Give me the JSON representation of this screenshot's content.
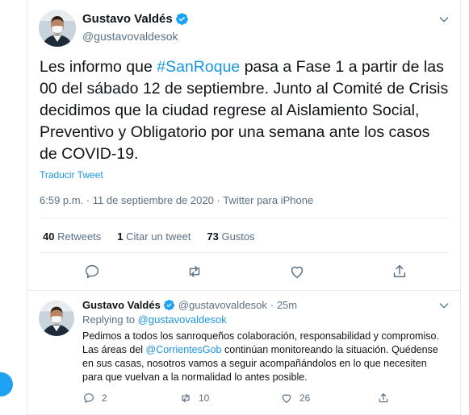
{
  "main_tweet": {
    "author_name": "Gustavo Valdés",
    "handle": "@gustavovaldesok",
    "text_before": "Les informo que ",
    "hashtag": "#SanRoque",
    "text_after": " pasa a Fase 1 a partir de las 00 del sábado 12 de septiembre. Junto al Comité de Crisis decidimos que la ciudad regrese al Aislamiento Social, Preventivo y Obligatorio por una semana ante los casos de COVID-19.",
    "translate_label": "Traducir Tweet",
    "timestamp": "6:59 p.m. · 11 de septiembre de 2020",
    "source": "Twitter para iPhone",
    "stats": {
      "retweets_count": "40",
      "retweets_label": "Retweets",
      "quotes_count": "1",
      "quotes_label": "Citar un tweet",
      "likes_count": "73",
      "likes_label": "Gustos"
    }
  },
  "reply_tweet": {
    "author_name": "Gustavo Valdés",
    "handle": "@gustavovaldesok",
    "time": "· 25m",
    "replying_prefix": "Replying to ",
    "replying_handle": "@gustavovaldesok",
    "text_1": "Pedimos a todos los sanroqueños colaboración, responsabilidad y compromiso. Las áreas del ",
    "mention": "@CorrientesGob",
    "text_2": " continúan monitoreando la situación. Quédense en sus casas, nosotros vamos a seguir acompañándolos en lo que necesiten para que vuelvan a la normalidad lo antes posible.",
    "reply_count": "2",
    "retweet_count": "10",
    "like_count": "26"
  },
  "colors": {
    "accent": "#1b95e0",
    "secondary_text": "#5b7083",
    "border": "#e6ecf0"
  }
}
